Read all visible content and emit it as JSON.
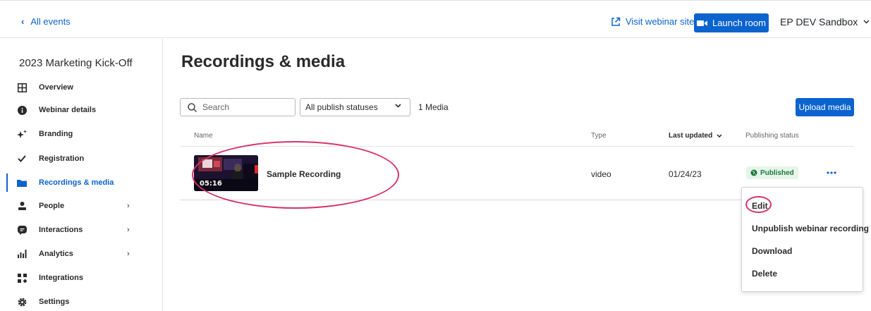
{
  "topbar": {
    "back_label": "All events",
    "visit_label": "Visit webinar site",
    "launch_label": "Launch room",
    "account_label": "EP DEV Sandbox"
  },
  "sidebar": {
    "event_title": "2023 Marketing Kick-Off",
    "items": [
      {
        "label": "Overview",
        "icon": "grid-icon"
      },
      {
        "label": "Webinar details",
        "icon": "info-icon"
      },
      {
        "label": "Branding",
        "icon": "sparkle-icon"
      },
      {
        "label": "Registration",
        "icon": "check-icon"
      },
      {
        "label": "Recordings & media",
        "icon": "folder-icon"
      },
      {
        "label": "People",
        "icon": "person-icon"
      },
      {
        "label": "Interactions",
        "icon": "chat-icon"
      },
      {
        "label": "Analytics",
        "icon": "bar-chart-icon"
      },
      {
        "label": "Integrations",
        "icon": "integrations-icon"
      },
      {
        "label": "Settings",
        "icon": "gear-icon"
      }
    ]
  },
  "main": {
    "title": "Recordings & media",
    "search_placeholder": "Search",
    "status_filter": "All publish statuses",
    "media_count": "1 Media",
    "upload_label": "Upload media",
    "columns": {
      "name": "Name",
      "type": "Type",
      "last_updated": "Last updated",
      "publishing_status": "Publishing status"
    },
    "rows": [
      {
        "name": "Sample Recording",
        "duration": "05:16",
        "type": "video",
        "last_updated": "01/24/23",
        "status": "Published"
      }
    ]
  },
  "menu": {
    "items": [
      "Edit",
      "Unpublish webinar recording",
      "Download",
      "Delete"
    ]
  },
  "colors": {
    "accent": "#0b63ce",
    "highlight": "#d7336a",
    "published": "#1b7a3a"
  }
}
